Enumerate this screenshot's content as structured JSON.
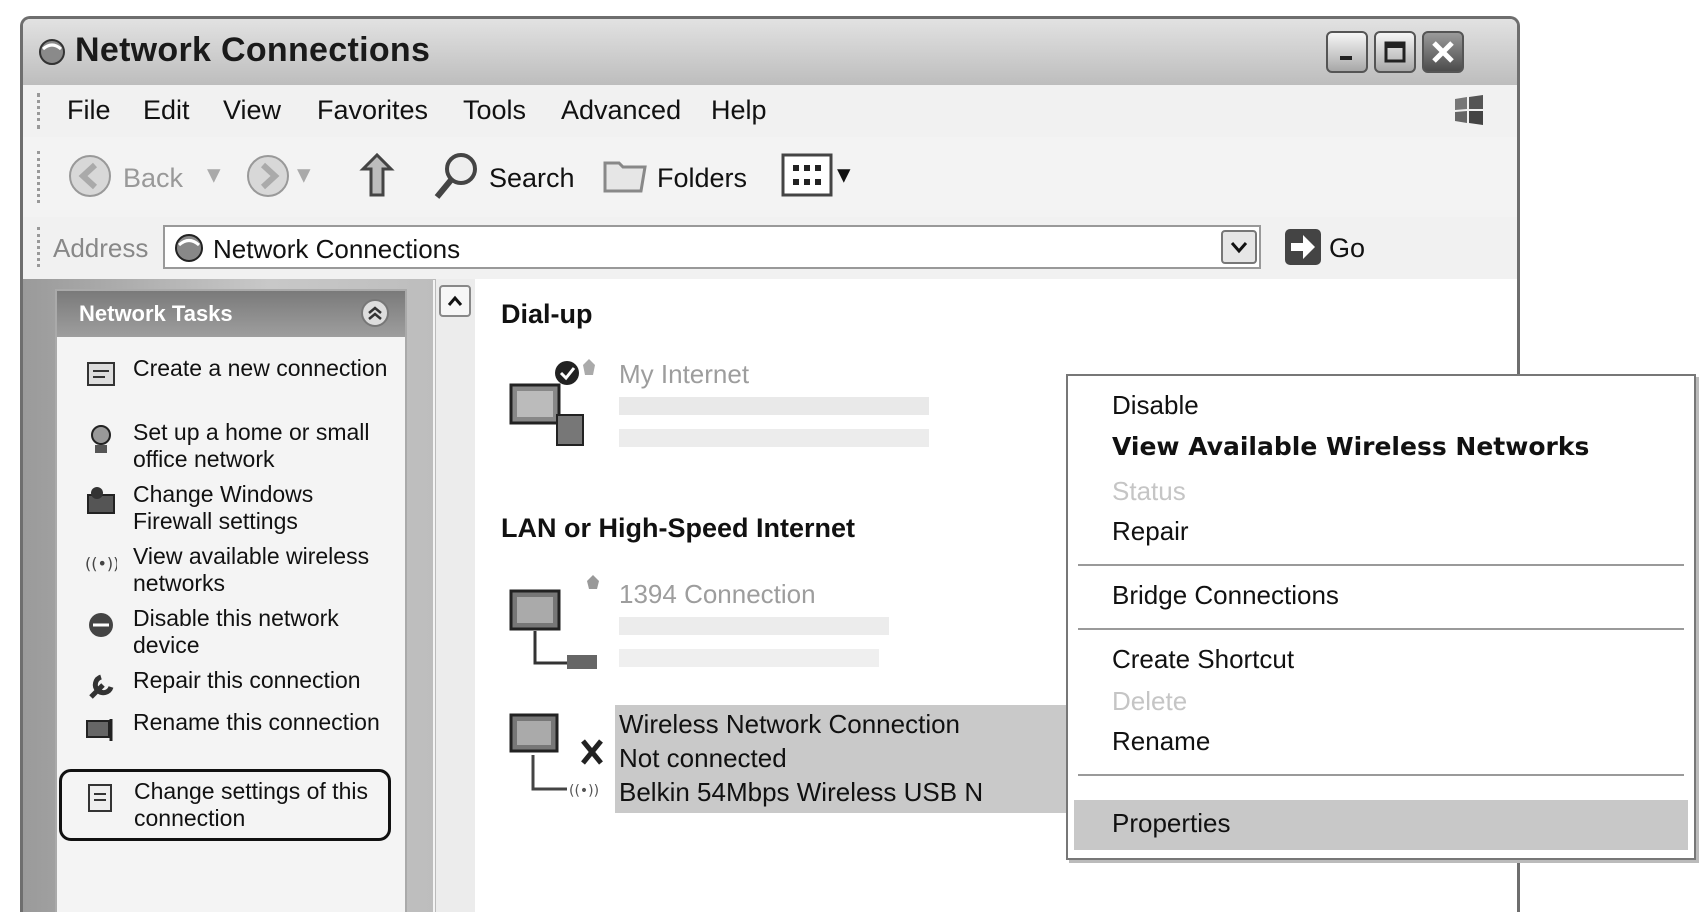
{
  "window": {
    "title": "Network Connections"
  },
  "menubar": {
    "items": [
      "File",
      "Edit",
      "View",
      "Favorites",
      "Tools",
      "Advanced",
      "Help"
    ]
  },
  "toolbar": {
    "back_label": "Back",
    "search_label": "Search",
    "folders_label": "Folders"
  },
  "address": {
    "label": "Address",
    "value": "Network Connections",
    "go_label": "Go"
  },
  "tasks": {
    "title": "Network Tasks",
    "items": [
      {
        "label": "Create a new connection",
        "icon": "new-connection-icon"
      },
      {
        "label": "Set up a home or small office network",
        "icon": "home-network-icon"
      },
      {
        "label": "Change Windows Firewall settings",
        "icon": "firewall-icon"
      },
      {
        "label": "View available wireless networks",
        "icon": "wireless-icon"
      },
      {
        "label": "Disable this network device",
        "icon": "disable-device-icon"
      },
      {
        "label": "Repair this connection",
        "icon": "repair-icon"
      },
      {
        "label": "Rename this connection",
        "icon": "rename-icon"
      },
      {
        "label": "Change settings of this connection",
        "icon": "settings-document-icon"
      }
    ]
  },
  "content": {
    "groups": [
      {
        "title": "Dial-up"
      },
      {
        "title": "LAN or High-Speed Internet"
      }
    ],
    "connections": [
      {
        "name": "My Internet"
      },
      {
        "name": "1394 Connection"
      },
      {
        "name": "Wireless Network Connection",
        "status": "Not connected",
        "device": "Belkin 54Mbps Wireless USB N"
      }
    ]
  },
  "context_menu": {
    "items": [
      {
        "label": "Disable",
        "style": "normal"
      },
      {
        "label": "View Available Wireless Networks",
        "style": "bold"
      },
      {
        "label": "Status",
        "style": "disabled"
      },
      {
        "label": "Repair",
        "style": "normal"
      },
      {
        "label": "Bridge Connections",
        "style": "normal"
      },
      {
        "label": "Create Shortcut",
        "style": "normal"
      },
      {
        "label": "Delete",
        "style": "disabled"
      },
      {
        "label": "Rename",
        "style": "normal"
      },
      {
        "label": "Properties",
        "style": "highlighted"
      }
    ]
  }
}
